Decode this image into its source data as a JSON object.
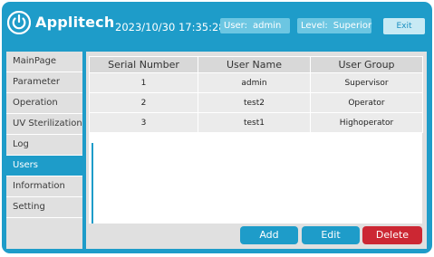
{
  "header": {
    "brand": "Applitech",
    "datetime": "2023/10/30 17:35:28",
    "user_label": "User:",
    "user_value": "admin",
    "level_label": "Level:",
    "level_value": "Superior",
    "exit_label": "Exit",
    "logo_icon": "power-icon"
  },
  "sidebar": {
    "items": [
      {
        "label": "MainPage"
      },
      {
        "label": "Parameter"
      },
      {
        "label": "Operation"
      },
      {
        "label": "UV Sterilization"
      },
      {
        "label": "Log"
      },
      {
        "label": "Users",
        "active": true
      },
      {
        "label": "Information"
      },
      {
        "label": "Setting"
      }
    ]
  },
  "table": {
    "columns": [
      "Serial Number",
      "User Name",
      "User Group"
    ],
    "rows": [
      [
        "1",
        "admin",
        "Supervisor"
      ],
      [
        "2",
        "test2",
        "Operator"
      ],
      [
        "3",
        "test1",
        "Highoperator"
      ]
    ]
  },
  "actions": {
    "add_label": "Add",
    "edit_label": "Edit",
    "delete_label": "Delete"
  },
  "colors": {
    "brand_blue": "#1e9cc9",
    "panel_gray": "#e0e0e0",
    "delete_red": "#cc2733"
  }
}
